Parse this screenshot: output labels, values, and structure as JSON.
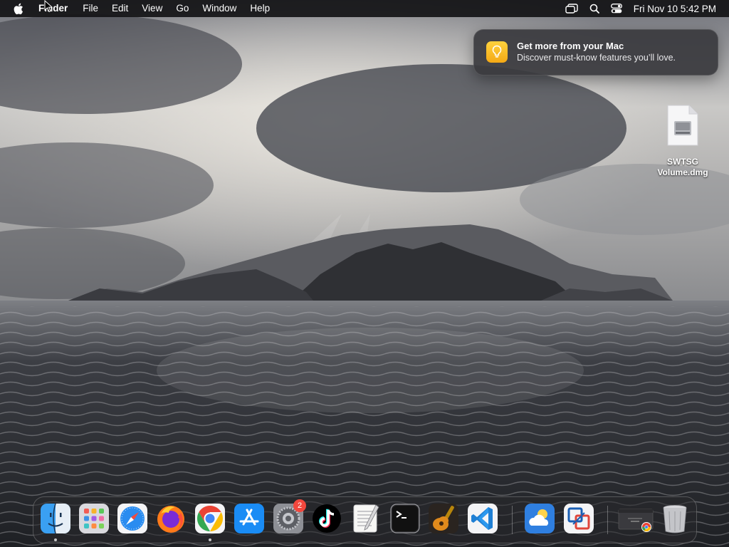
{
  "menubar": {
    "app_name": "Finder",
    "items": [
      "File",
      "Edit",
      "View",
      "Go",
      "Window",
      "Help"
    ],
    "clock": "Fri Nov 10  5:42 PM"
  },
  "notification": {
    "title": "Get more from your Mac",
    "body": "Discover must-know features you’ll love."
  },
  "desktop_file": {
    "label_line1": "SWTSG",
    "label_line2": "Volume.dmg"
  },
  "dock": {
    "settings_badge": "2",
    "apps": [
      "finder-icon",
      "launchpad-icon",
      "safari-icon",
      "firefox-icon",
      "chrome-icon",
      "app-store-icon",
      "system-settings-icon",
      "tiktok-icon",
      "textedit-icon",
      "terminal-icon",
      "garageband-icon",
      "vscode-icon",
      "weather-icon",
      "vmware-icon",
      "chrome-window-icon",
      "trash-icon"
    ]
  },
  "colors": {
    "menubar_bg": "#141416",
    "badge": "#f2473d",
    "tips": "#f4a915"
  }
}
